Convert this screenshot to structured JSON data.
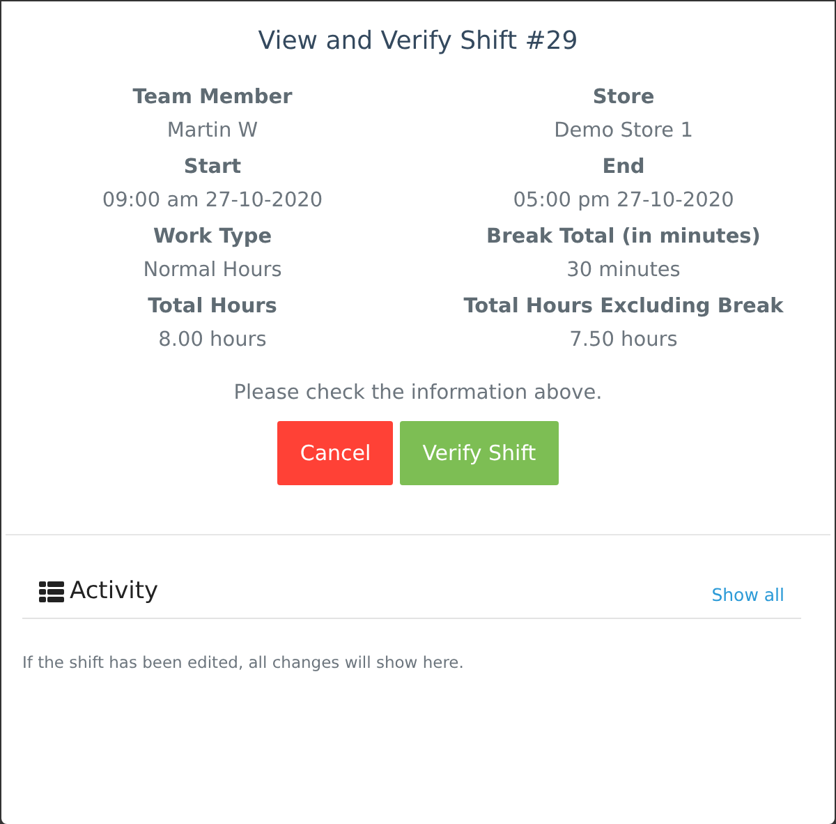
{
  "modal": {
    "title": "View and Verify Shift #29"
  },
  "fields": [
    {
      "label": "Team Member",
      "value": "Martin W"
    },
    {
      "label": "Store",
      "value": "Demo Store 1"
    },
    {
      "label": "Start",
      "value": "09:00 am 27-10-2020"
    },
    {
      "label": "End",
      "value": "05:00 pm 27-10-2020"
    },
    {
      "label": "Work Type",
      "value": "Normal Hours"
    },
    {
      "label": "Break Total (in minutes)",
      "value": "30 minutes"
    },
    {
      "label": "Total Hours",
      "value": "8.00 hours"
    },
    {
      "label": "Total Hours Excluding Break",
      "value": "7.50 hours"
    }
  ],
  "prompt": "Please check the information above.",
  "buttons": [
    {
      "label": "Cancel",
      "kind": "danger"
    },
    {
      "label": "Verify Shift",
      "kind": "success"
    }
  ],
  "activity": {
    "title": "Activity",
    "link": "Show all",
    "empty_text": "If the shift has been edited, all changes will show here."
  }
}
